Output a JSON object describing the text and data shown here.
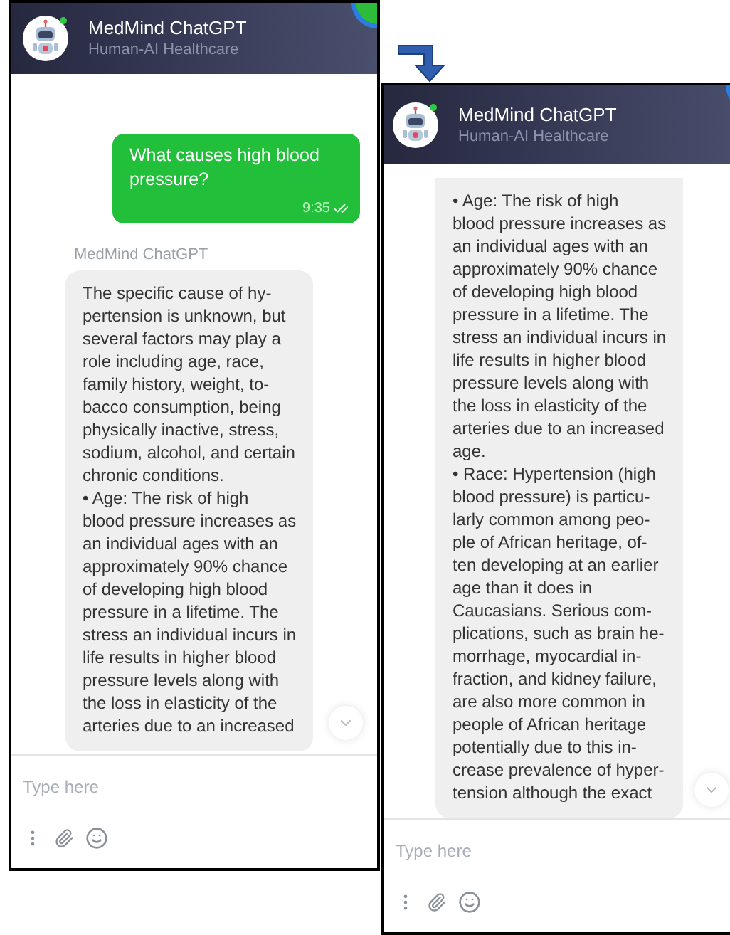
{
  "panels": [
    {
      "header": {
        "title": "MedMind ChatGPT",
        "subtitle": "Human-AI Healthcare",
        "online": true
      },
      "messages": [
        {
          "kind": "user",
          "text": "What causes high blood\npressure?",
          "time": "9:35",
          "read": true
        },
        {
          "kind": "bot",
          "sender": "MedMind ChatGPT",
          "text": "The specific cause of hy-\npertension is unknown, but\nseveral factors may play a\nrole including age, race,\nfamily history, weight, to-\nbacco consumption, being\nphysically inactive, stress,\nsodium, alcohol, and certain\nchronic conditions.\n• Age: The risk of high\nblood pressure increases as\nan individual ages with an\napproximately 90% chance\nof developing high blood\npressure in a lifetime. The\nstress an individual incurs in\nlife results in higher blood\npressure levels along with\nthe loss in elasticity of the\narteries due to an increased"
        }
      ],
      "input": {
        "placeholder": "Type here"
      }
    },
    {
      "header": {
        "title": "MedMind ChatGPT",
        "subtitle": "Human-AI Healthcare",
        "online": true
      },
      "messages": [
        {
          "kind": "bot",
          "text": "• Age: The risk of high\nblood pressure increases as\nan individual ages with an\napproximately 90% chance\nof developing high blood\npressure in a lifetime. The\nstress an individual incurs in\nlife results in higher blood\npressure levels along with\nthe loss in elasticity of the\narteries due to an increased\nage.\n• Race: Hypertension (high\nblood pressure) is particu-\nlarly common among peo-\nple of African heritage, of-\nten developing at an earlier\nage than it does in\nCaucasians. Serious com-\nplications, such as brain he-\nmorrhage, myocardial in-\nfraction, and kidney failure,\nare also more common in\npeople of African heritage\npotentially due to this in-\ncrease prevalence of hyper-\ntension although the exact"
        }
      ],
      "input": {
        "placeholder": "Type here"
      }
    }
  ]
}
